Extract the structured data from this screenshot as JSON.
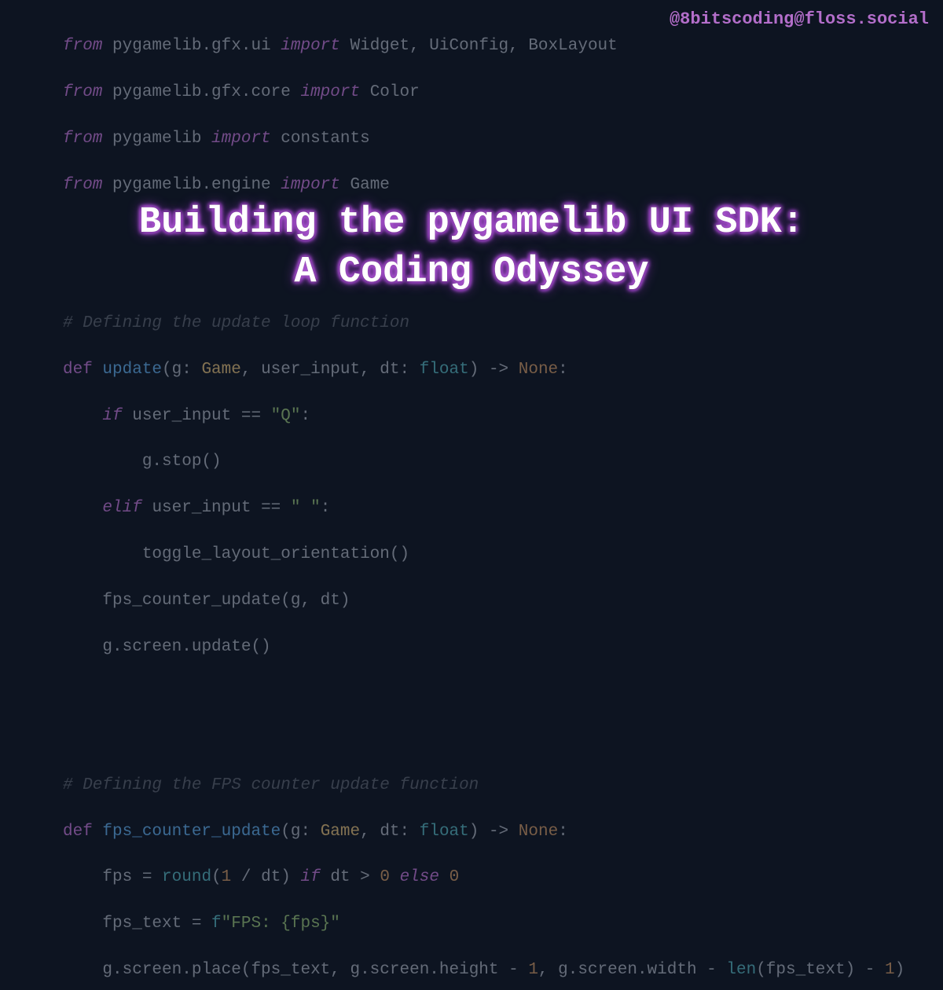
{
  "watermark": "@8bitscoding@floss.social",
  "title": "Building the pygamelib UI SDK:\nA Coding Odyssey",
  "code": {
    "line1": {
      "from": "from",
      "mod": " pygamelib.gfx.ui ",
      "imp": "import",
      "rest": " Widget, UiConfig, BoxLayout"
    },
    "line2": {
      "from": "from",
      "mod": " pygamelib.gfx.core ",
      "imp": "import",
      "rest": " Color"
    },
    "line3": {
      "from": "from",
      "mod": " pygamelib ",
      "imp": "import",
      "rest": " constants"
    },
    "line4": {
      "from": "from",
      "mod": " pygamelib.engine ",
      "imp": "import",
      "rest": " Game"
    },
    "comment1": "# Defining the update loop function",
    "def1": {
      "def": "def",
      "name": " update",
      "sig_open": "(g: ",
      "type1": "Game",
      "mid": ", user_input, dt: ",
      "type2": "float",
      "sig_close": ") -> ",
      "ret": "None",
      "colon": ":"
    },
    "if1": {
      "indent": "    ",
      "kw": "if",
      "cond": " user_input == ",
      "str": "\"Q\"",
      "colon": ":"
    },
    "stop": {
      "indent": "        ",
      "text": "g.stop()"
    },
    "elif1": {
      "indent": "    ",
      "kw": "elif",
      "cond": " user_input == ",
      "str": "\" \"",
      "colon": ":"
    },
    "toggle": {
      "indent": "        ",
      "text": "toggle_layout_orientation()"
    },
    "fpscall": {
      "indent": "    ",
      "text": "fps_counter_update(g, dt)"
    },
    "screenupd": {
      "indent": "    ",
      "text": "g.screen.update()"
    },
    "comment2": "# Defining the FPS counter update function",
    "def2": {
      "def": "def",
      "name": " fps_counter_update",
      "sig_open": "(g: ",
      "type1": "Game",
      "mid": ", dt: ",
      "type2": "float",
      "sig_close": ") -> ",
      "ret": "None",
      "colon": ":"
    },
    "fpsline": {
      "indent": "    ",
      "a": "fps = ",
      "round": "round",
      "b": "(",
      "one": "1",
      "c": " / dt) ",
      "if": "if",
      "d": " dt > ",
      "zero1": "0",
      "sp": " ",
      "else": "else",
      "sp2": " ",
      "zero2": "0"
    },
    "fpstext": {
      "indent": "    ",
      "a": "fps_text = ",
      "f": "f",
      "str": "\"FPS: {fps}\""
    },
    "place": {
      "indent": "    ",
      "a": "g.screen.place(fps_text, g.screen.height - ",
      "one1": "1",
      "b": ", g.screen.width - ",
      "len": "len",
      "c": "(fps_text) - ",
      "one2": "1",
      "d": ")"
    }
  }
}
